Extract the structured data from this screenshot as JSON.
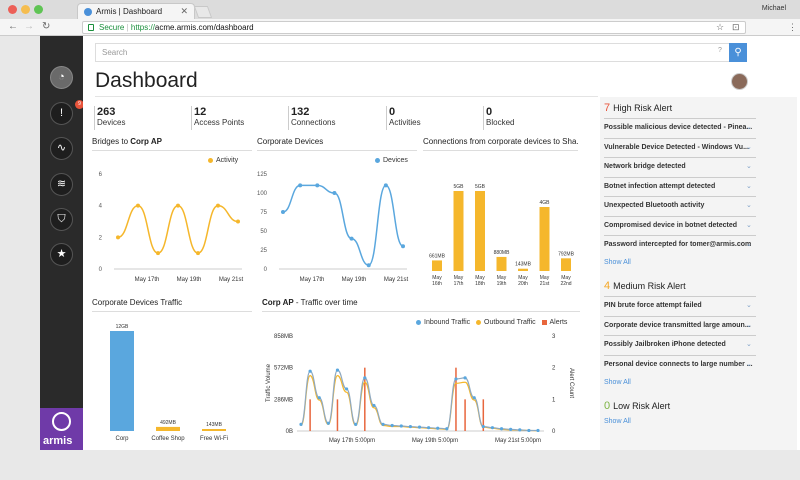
{
  "browser": {
    "tab_title": "Armis | Dashboard",
    "profile": "Michael",
    "secure_label": "Secure",
    "url_scheme": "https://",
    "url_rest": "acme.armis.com/dashboard"
  },
  "search": {
    "placeholder": "Search",
    "help": "?"
  },
  "page": {
    "title": "Dashboard",
    "brand": "armis"
  },
  "stats": [
    {
      "value": "263",
      "label": "Devices"
    },
    {
      "value": "12",
      "label": "Access Points"
    },
    {
      "value": "132",
      "label": "Connections"
    },
    {
      "value": "0",
      "label": "Activities"
    },
    {
      "value": "0",
      "label": "Blocked"
    }
  ],
  "panels": {
    "bridges_prefix": "Bridges to ",
    "bridges_target": "Corp AP",
    "corporate_devices": "Corporate Devices",
    "connections": "Connections from corporate devices to Sha...",
    "traffic": "Corporate Devices Traffic",
    "corp_ap_bold": "Corp AP",
    "corp_ap_rest": " - Traffic over time"
  },
  "sidebar": {
    "badge": "9"
  },
  "alerts": {
    "high": {
      "count": "7",
      "label": "High Risk Alert",
      "items": [
        "Possible malicious device detected - Pinea...",
        "Vulnerable Device Detected - Windows Vu...",
        "Network bridge detected",
        "Botnet infection attempt detected",
        "Unexpected Bluetooth activity",
        "Compromised device in botnet detected",
        "Password intercepted for tomer@armis.com"
      ],
      "show_all": "Show All"
    },
    "medium": {
      "count": "4",
      "label": "Medium Risk Alert",
      "items": [
        "PIN brute force attempt failed",
        "Corporate device transmitted large amoun...",
        "Possibly Jailbroken iPhone detected",
        "Personal device connects to large number ..."
      ],
      "show_all": "Show All"
    },
    "low": {
      "count": "0",
      "label": "Low Risk Alert",
      "show_all": "Show All"
    }
  },
  "colors": {
    "accent": "#f5b72c",
    "blue": "#5aa7de",
    "red": "#e8663d",
    "purple": "#6f3aa8",
    "high": "#e8533a",
    "medium": "#f5a623",
    "low": "#7cb342"
  },
  "chart_data": [
    {
      "type": "line",
      "title": "Bridges to Corp AP",
      "series": [
        {
          "name": "Activity",
          "values": [
            2,
            4,
            1,
            4,
            1,
            4,
            3
          ]
        }
      ],
      "x_ticks": [
        "May 17th",
        "May 19th",
        "May 21st"
      ],
      "y_ticks": [
        0,
        2,
        4,
        6
      ],
      "ylim": [
        0,
        6
      ]
    },
    {
      "type": "line",
      "title": "Corporate Devices",
      "series": [
        {
          "name": "Devices",
          "values": [
            75,
            110,
            110,
            100,
            40,
            5,
            110,
            30
          ]
        }
      ],
      "x_ticks": [
        "May 17th",
        "May 19th",
        "May 21st"
      ],
      "y_ticks": [
        0,
        25,
        50,
        75,
        100,
        125
      ],
      "ylim": [
        0,
        125
      ]
    },
    {
      "type": "bar",
      "title": "Connections from corporate devices to Sha...",
      "categories": [
        "May 16th",
        "May 17th",
        "May 18th",
        "May 19th",
        "May 20th",
        "May 21st",
        "May 22nd"
      ],
      "values": [
        0.661,
        5,
        5,
        0.88,
        0.143,
        4,
        0.792
      ],
      "value_labels": [
        "661MB",
        "5GB",
        "5GB",
        "880MB",
        "143MB",
        "4GB",
        "792MB"
      ]
    },
    {
      "type": "bar",
      "title": "Corporate Devices Traffic",
      "categories": [
        "Corp",
        "Coffee Shop",
        "Free Wi-Fi"
      ],
      "values": [
        12,
        0.492,
        0.143
      ],
      "value_labels": [
        "12GB",
        "492MB",
        "143MB"
      ]
    },
    {
      "type": "line",
      "title": "Corp AP - Traffic over time",
      "ylabel": "Traffic Volume",
      "y2label": "Alert Count",
      "y_ticks": [
        "0B",
        "286MB",
        "572MB",
        "858MB"
      ],
      "y2_ticks": [
        "0",
        "1",
        "2",
        "3"
      ],
      "x_ticks": [
        "May 17th 5:00pm",
        "May 19th 5:00pm",
        "May 21st 5:00pm"
      ],
      "series": [
        {
          "name": "Inbound Traffic",
          "values": [
            60,
            540,
            300,
            70,
            550,
            380,
            60,
            480,
            230,
            60,
            50,
            45,
            40,
            35,
            30,
            25,
            20,
            470,
            480,
            300,
            40,
            30,
            20,
            15,
            10,
            5,
            5
          ]
        },
        {
          "name": "Outbound Traffic",
          "values": [
            50,
            500,
            280,
            60,
            500,
            350,
            50,
            440,
            210,
            50,
            40,
            40,
            35,
            30,
            25,
            20,
            15,
            430,
            440,
            280,
            35,
            25,
            15,
            10,
            8,
            5,
            3
          ]
        },
        {
          "name": "Alerts",
          "alerts_at": [
            {
              "i": 1,
              "n": 1
            },
            {
              "i": 4,
              "n": 1
            },
            {
              "i": 7,
              "n": 2
            },
            {
              "i": 17,
              "n": 2
            },
            {
              "i": 18,
              "n": 1
            },
            {
              "i": 20,
              "n": 1
            }
          ]
        }
      ]
    }
  ]
}
